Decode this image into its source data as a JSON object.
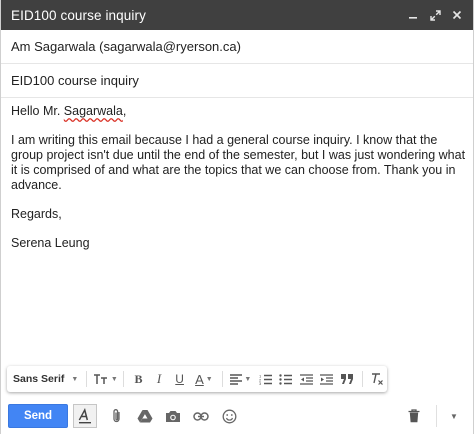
{
  "window": {
    "title": "EID100 course inquiry"
  },
  "compose": {
    "recipient": "Am Sagarwala (sagarwala@ryerson.ca)",
    "subject": "EID100 course inquiry",
    "body": {
      "greeting_prefix": "Hello Mr. ",
      "greeting_name": "Sagarwala",
      "greeting_suffix": ",",
      "paragraph": "I am writing this email because I had a general course inquiry. I know that the group project isn't due until the end of the semester, but I was just wondering what it is comprised of and what are the topics that we can choose from. Thank you in advance.",
      "closing": "Regards,",
      "signature": "Serena Leung"
    }
  },
  "formatting_toolbar": {
    "font_family": "Sans Serif"
  },
  "bottom_bar": {
    "send_label": "Send"
  },
  "colors": {
    "titlebar": "#404040",
    "send": "#4285f4"
  }
}
